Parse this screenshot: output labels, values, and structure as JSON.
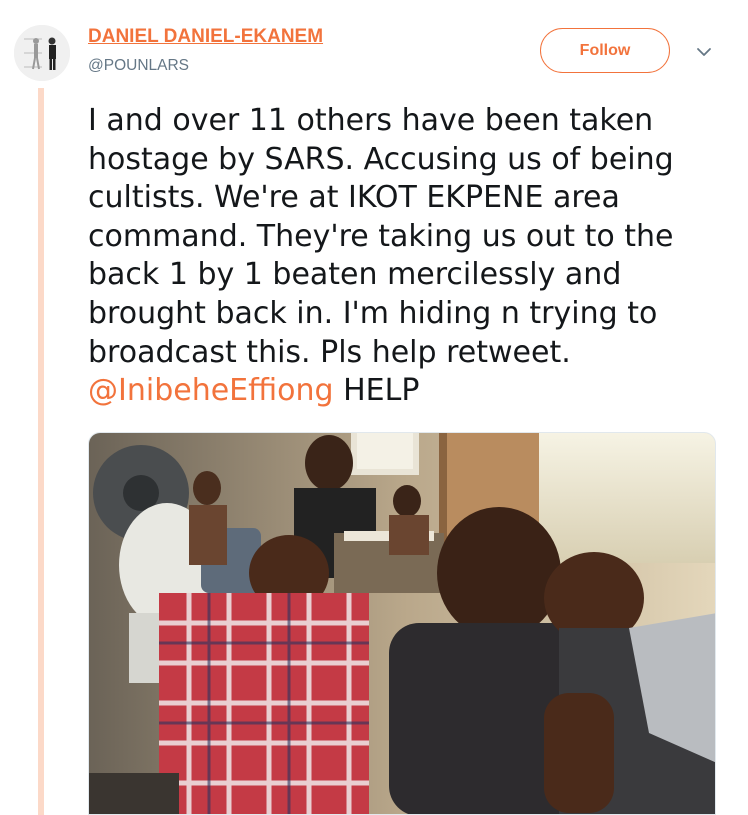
{
  "author": {
    "display_name": "DANIEL DANIEL-EKANEM",
    "handle": "@POUNLARS"
  },
  "follow_button": {
    "label": "Follow"
  },
  "tweet": {
    "text": "I and over 11 others have been taken hostage by SARS. Accusing us of being cultists. We're at IKOT EKPENE area command. They're taking us out to the back 1 by 1 beaten mercilessly and brought back in. I'm hiding n trying to broadcast this. Pls help retweet.",
    "mention": "@InibeheEffiong",
    "trailing": "HELP"
  },
  "icons": {
    "more_menu": "chevron-down-icon"
  },
  "colors": {
    "accent": "#f2733c",
    "thread_line": "#fcd9c8",
    "text": "#14171a",
    "secondary_text": "#657786"
  }
}
